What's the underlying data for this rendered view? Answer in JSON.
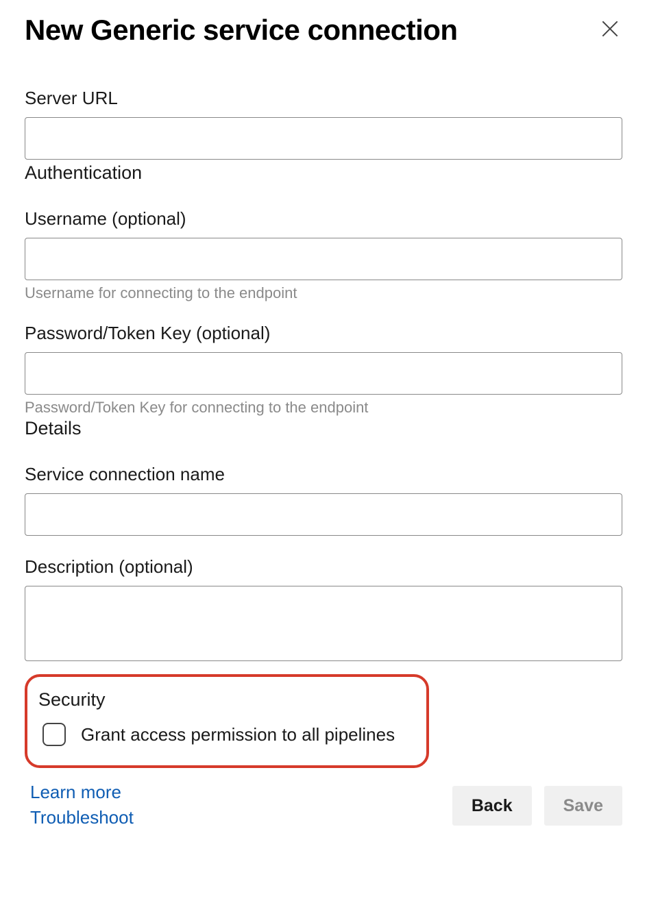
{
  "header": {
    "title": "New Generic service connection"
  },
  "fields": {
    "server_url": {
      "label": "Server URL",
      "value": ""
    },
    "username": {
      "label": "Username (optional)",
      "value": "",
      "hint": "Username for connecting to the endpoint"
    },
    "password": {
      "label": "Password/Token Key (optional)",
      "value": "",
      "hint": "Password/Token Key for connecting to the endpoint"
    },
    "connection_name": {
      "label": "Service connection name",
      "value": ""
    },
    "description": {
      "label": "Description (optional)",
      "value": ""
    }
  },
  "sections": {
    "authentication": "Authentication",
    "details": "Details",
    "security": "Security"
  },
  "security": {
    "checkbox_label": "Grant access permission to all pipelines",
    "checked": false
  },
  "links": {
    "learn_more": "Learn more",
    "troubleshoot": "Troubleshoot"
  },
  "buttons": {
    "back": "Back",
    "save": "Save"
  }
}
